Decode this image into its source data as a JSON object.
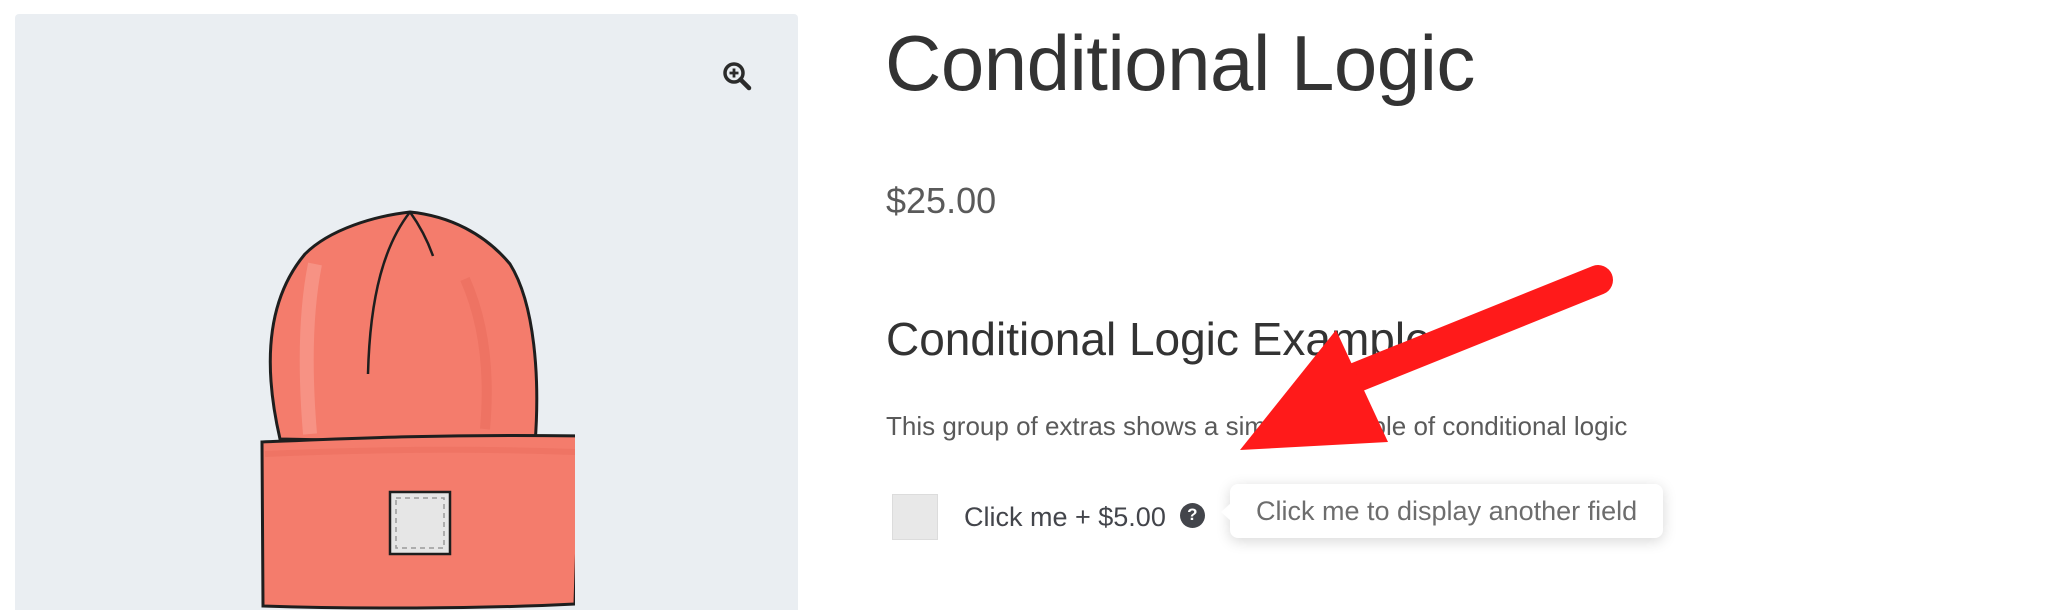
{
  "product": {
    "title": "Conditional Logic",
    "price": "$25.00"
  },
  "gallery": {
    "zoom_icon": "magnify-plus-icon",
    "image": "red-beanie-hat-illustration"
  },
  "extras_group": {
    "title": "Conditional Logic Example",
    "description": "This group of extras shows a simple example of conditional logic",
    "option": {
      "label": "Click me + $5.00",
      "checked": false,
      "help_icon": "question-circle-icon",
      "tooltip": "Click me to display another field"
    }
  },
  "colors": {
    "gallery_background": "#eaeef2",
    "annotation_arrow": "#ff1a1a",
    "hat": "#f47c6c"
  }
}
